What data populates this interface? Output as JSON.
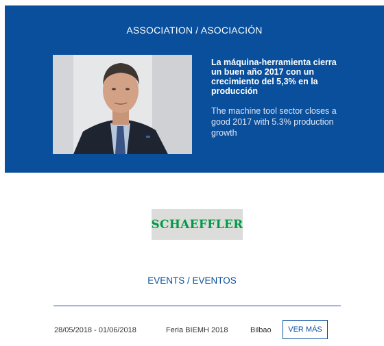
{
  "association": {
    "title": "ASSOCIATION / ASOCIACIÓN",
    "headline": "La máquina-herramienta cierra un buen año 2017 con un crecimiento del 5,3% en la producción",
    "subheadline": "The machine tool sector closes a good 2017 with 5.3% production growth"
  },
  "sponsor": {
    "logo_text": "SCHAEFFLER",
    "logo_color": "#009a44"
  },
  "events": {
    "title": "EVENTS / EVENTOS",
    "items": [
      {
        "dates": "28/05/2018 - 01/06/2018",
        "name": "Feria BIEMH 2018",
        "city": "Bilbao",
        "button_label": "VER MÁS"
      }
    ]
  },
  "colors": {
    "brand_blue": "#0a4f9c",
    "background": "#ffffff"
  }
}
